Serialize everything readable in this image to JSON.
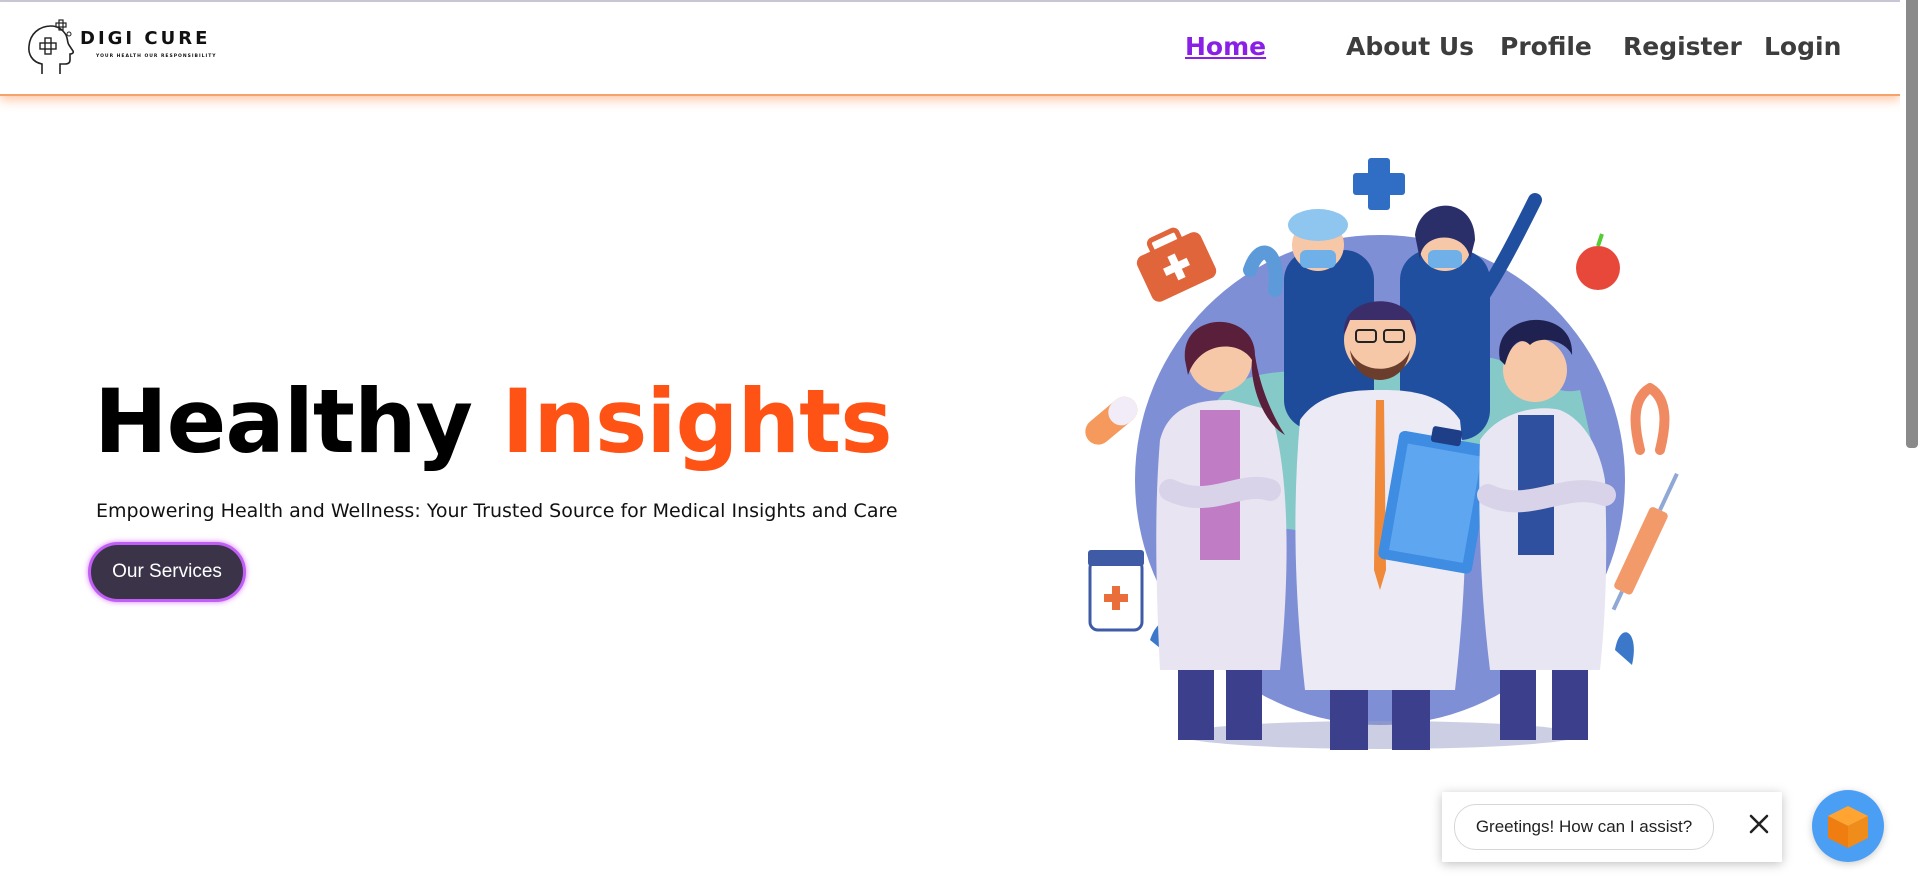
{
  "brand": {
    "name": "DIGI CURE",
    "tagline": "YOUR HEALTH OUR RESPONSIBILITY",
    "logo_icon": "head-cross-icon"
  },
  "nav": {
    "items": [
      {
        "label": "Home",
        "active": true
      },
      {
        "label": "About Us",
        "active": false
      },
      {
        "label": "Profile",
        "active": false
      },
      {
        "label": "Register",
        "active": false
      },
      {
        "label": "Login",
        "active": false
      }
    ]
  },
  "hero": {
    "title_part1": "Healthy",
    "title_part2": "Insights",
    "subtitle": "Empowering Health and Wellness: Your Trusted Source for Medical Insights and Care",
    "cta_label": "Our Services",
    "illustration": "medical-team-illustration"
  },
  "chat": {
    "greeting": "Greetings! How can I assist?",
    "close_icon": "close-icon",
    "launcher_icon": "cube-icon"
  },
  "colors": {
    "accent_orange": "#ff5316",
    "nav_active": "#8a1fe6",
    "nav_text": "#3d3d3d",
    "cta_bg": "#3b3348",
    "cta_border": "#c15ef5",
    "chat_launcher": "#4a9ff5"
  }
}
